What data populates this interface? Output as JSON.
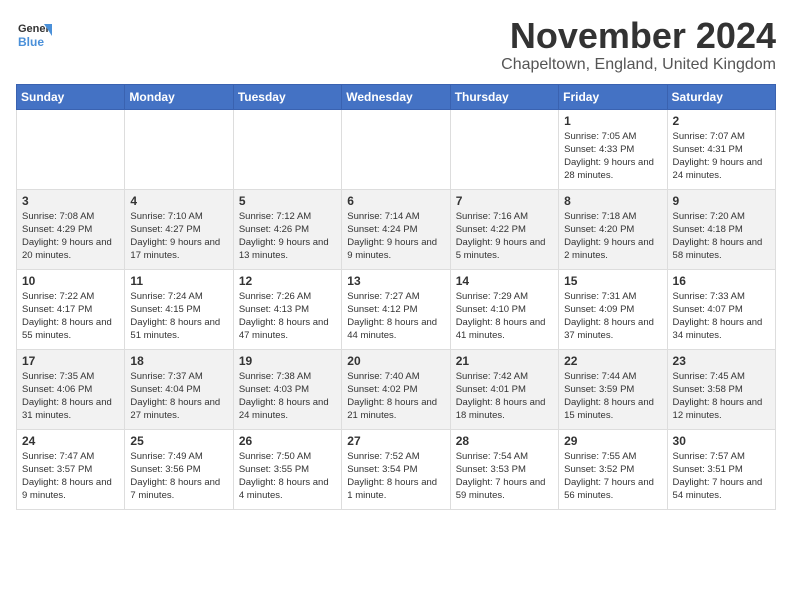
{
  "logo": {
    "text_general": "General",
    "text_blue": "Blue"
  },
  "title": "November 2024",
  "location": "Chapeltown, England, United Kingdom",
  "days_of_week": [
    "Sunday",
    "Monday",
    "Tuesday",
    "Wednesday",
    "Thursday",
    "Friday",
    "Saturday"
  ],
  "weeks": [
    [
      {
        "day": "",
        "info": ""
      },
      {
        "day": "",
        "info": ""
      },
      {
        "day": "",
        "info": ""
      },
      {
        "day": "",
        "info": ""
      },
      {
        "day": "",
        "info": ""
      },
      {
        "day": "1",
        "info": "Sunrise: 7:05 AM\nSunset: 4:33 PM\nDaylight: 9 hours and 28 minutes."
      },
      {
        "day": "2",
        "info": "Sunrise: 7:07 AM\nSunset: 4:31 PM\nDaylight: 9 hours and 24 minutes."
      }
    ],
    [
      {
        "day": "3",
        "info": "Sunrise: 7:08 AM\nSunset: 4:29 PM\nDaylight: 9 hours and 20 minutes."
      },
      {
        "day": "4",
        "info": "Sunrise: 7:10 AM\nSunset: 4:27 PM\nDaylight: 9 hours and 17 minutes."
      },
      {
        "day": "5",
        "info": "Sunrise: 7:12 AM\nSunset: 4:26 PM\nDaylight: 9 hours and 13 minutes."
      },
      {
        "day": "6",
        "info": "Sunrise: 7:14 AM\nSunset: 4:24 PM\nDaylight: 9 hours and 9 minutes."
      },
      {
        "day": "7",
        "info": "Sunrise: 7:16 AM\nSunset: 4:22 PM\nDaylight: 9 hours and 5 minutes."
      },
      {
        "day": "8",
        "info": "Sunrise: 7:18 AM\nSunset: 4:20 PM\nDaylight: 9 hours and 2 minutes."
      },
      {
        "day": "9",
        "info": "Sunrise: 7:20 AM\nSunset: 4:18 PM\nDaylight: 8 hours and 58 minutes."
      }
    ],
    [
      {
        "day": "10",
        "info": "Sunrise: 7:22 AM\nSunset: 4:17 PM\nDaylight: 8 hours and 55 minutes."
      },
      {
        "day": "11",
        "info": "Sunrise: 7:24 AM\nSunset: 4:15 PM\nDaylight: 8 hours and 51 minutes."
      },
      {
        "day": "12",
        "info": "Sunrise: 7:26 AM\nSunset: 4:13 PM\nDaylight: 8 hours and 47 minutes."
      },
      {
        "day": "13",
        "info": "Sunrise: 7:27 AM\nSunset: 4:12 PM\nDaylight: 8 hours and 44 minutes."
      },
      {
        "day": "14",
        "info": "Sunrise: 7:29 AM\nSunset: 4:10 PM\nDaylight: 8 hours and 41 minutes."
      },
      {
        "day": "15",
        "info": "Sunrise: 7:31 AM\nSunset: 4:09 PM\nDaylight: 8 hours and 37 minutes."
      },
      {
        "day": "16",
        "info": "Sunrise: 7:33 AM\nSunset: 4:07 PM\nDaylight: 8 hours and 34 minutes."
      }
    ],
    [
      {
        "day": "17",
        "info": "Sunrise: 7:35 AM\nSunset: 4:06 PM\nDaylight: 8 hours and 31 minutes."
      },
      {
        "day": "18",
        "info": "Sunrise: 7:37 AM\nSunset: 4:04 PM\nDaylight: 8 hours and 27 minutes."
      },
      {
        "day": "19",
        "info": "Sunrise: 7:38 AM\nSunset: 4:03 PM\nDaylight: 8 hours and 24 minutes."
      },
      {
        "day": "20",
        "info": "Sunrise: 7:40 AM\nSunset: 4:02 PM\nDaylight: 8 hours and 21 minutes."
      },
      {
        "day": "21",
        "info": "Sunrise: 7:42 AM\nSunset: 4:01 PM\nDaylight: 8 hours and 18 minutes."
      },
      {
        "day": "22",
        "info": "Sunrise: 7:44 AM\nSunset: 3:59 PM\nDaylight: 8 hours and 15 minutes."
      },
      {
        "day": "23",
        "info": "Sunrise: 7:45 AM\nSunset: 3:58 PM\nDaylight: 8 hours and 12 minutes."
      }
    ],
    [
      {
        "day": "24",
        "info": "Sunrise: 7:47 AM\nSunset: 3:57 PM\nDaylight: 8 hours and 9 minutes."
      },
      {
        "day": "25",
        "info": "Sunrise: 7:49 AM\nSunset: 3:56 PM\nDaylight: 8 hours and 7 minutes."
      },
      {
        "day": "26",
        "info": "Sunrise: 7:50 AM\nSunset: 3:55 PM\nDaylight: 8 hours and 4 minutes."
      },
      {
        "day": "27",
        "info": "Sunrise: 7:52 AM\nSunset: 3:54 PM\nDaylight: 8 hours and 1 minute."
      },
      {
        "day": "28",
        "info": "Sunrise: 7:54 AM\nSunset: 3:53 PM\nDaylight: 7 hours and 59 minutes."
      },
      {
        "day": "29",
        "info": "Sunrise: 7:55 AM\nSunset: 3:52 PM\nDaylight: 7 hours and 56 minutes."
      },
      {
        "day": "30",
        "info": "Sunrise: 7:57 AM\nSunset: 3:51 PM\nDaylight: 7 hours and 54 minutes."
      }
    ]
  ]
}
